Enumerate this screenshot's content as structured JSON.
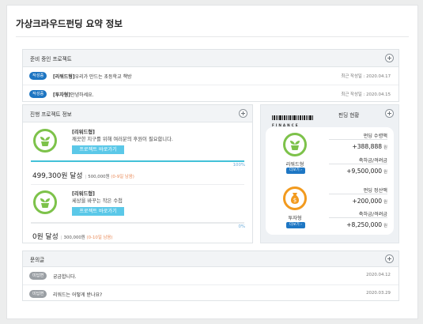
{
  "page_title": "가상크라우드펀딩 요약 정보",
  "prep": {
    "title": "준비 중인 프로젝트",
    "rows": [
      {
        "badge": "작성중",
        "type": "[리워드형]",
        "text": "우리가 만드는 초등학교 책방",
        "date": "최근 작성일 : 2020.04.17"
      },
      {
        "badge": "작성중",
        "type": "[투자형]",
        "text": "안녕하세요.",
        "date": "최근 작성일 : 2020.04.15"
      }
    ]
  },
  "ongoing": {
    "title": "진행 프로젝트 정보",
    "projects": [
      {
        "kind": "[리워드형]",
        "desc": "깨끗한 지구를 위해 여러분의 후원이 필요합니다.",
        "button": "프로젝트 바로가기",
        "percent_label": "100%",
        "progress": 1.0,
        "amount": "499,300원 달성",
        "goal": "500,000원",
        "remain": "(0-9일 남음)"
      },
      {
        "kind": "[리워드형]",
        "desc": "세상을 바꾸는 작은 수첩",
        "button": "프로젝트 바로가기",
        "percent_label": "0%",
        "progress": 0.0,
        "amount": "0원 달성",
        "goal": "300,000원",
        "remain": "(0-10일 남음)"
      }
    ]
  },
  "funding": {
    "title": "펀딩 현황",
    "logo_text": "FINANCE",
    "reward": {
      "label": "리워드형",
      "more": "더보기",
      "rows": [
        {
          "label": "펀딩 수령액",
          "value": "+388,888",
          "unit": "원"
        },
        {
          "label": "축하금/격려금",
          "value": "+9,500,000",
          "unit": "원"
        }
      ]
    },
    "invest": {
      "label": "투자형",
      "more": "더보기",
      "rows": [
        {
          "label": "펀딩 정산액",
          "value": "+200,000",
          "unit": "원"
        },
        {
          "label": "축하금/격려금",
          "value": "+8,250,000",
          "unit": "원"
        }
      ]
    }
  },
  "inquiry": {
    "title": "문의글",
    "rows": [
      {
        "badge": "미답변",
        "text": "궁금합니다.",
        "date": "2020.04.12"
      },
      {
        "badge": "미답변",
        "text": "리워드는 어떻게 받나요?",
        "date": "2020.03.29"
      }
    ]
  },
  "colors": {
    "accent": "#1d75c2",
    "green": "#7dc24a",
    "orange": "#f29a1e",
    "progress": "#43c1d8",
    "button": "#5bc8e8"
  },
  "icons": {
    "expand": "plus-circle-icon",
    "reward": "plant-pot-icon",
    "invest": "money-bag-icon"
  }
}
